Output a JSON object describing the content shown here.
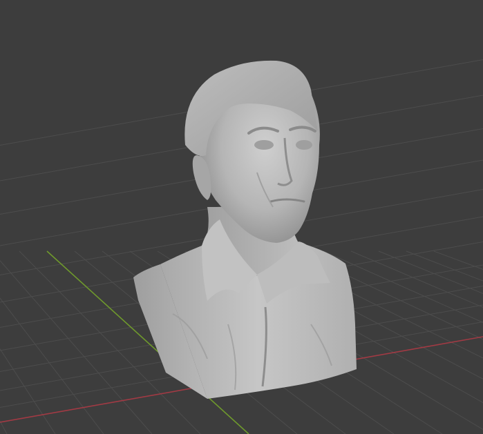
{
  "viewport": {
    "editor": "3D Viewport",
    "shading_mode": "solid",
    "object": {
      "type": "sculpted-mesh",
      "subject": "male-bust"
    },
    "overlays": {
      "floor_grid": true,
      "x_axis_line": true,
      "y_axis_line": true
    },
    "colors": {
      "background": "#3d3d3d",
      "grid_line": "#4d4d4d",
      "x_axis": "#a23a44",
      "y_axis": "#6f9a2c",
      "mesh_base": "#b3b3b3",
      "mesh_highlight": "#d2d2d2",
      "mesh_shadow": "#8a8a8a"
    }
  }
}
